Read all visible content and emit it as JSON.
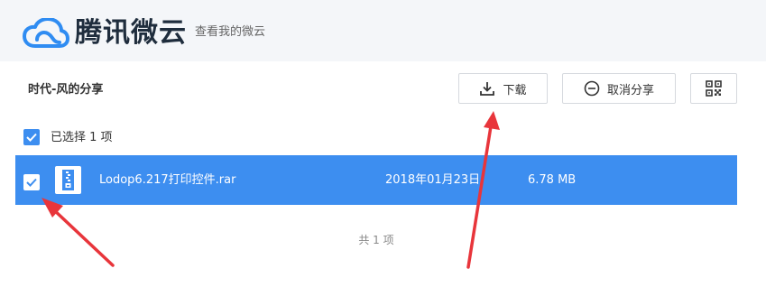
{
  "header": {
    "brand": "腾讯微云",
    "link": "查看我的微云"
  },
  "share": {
    "title": "时代-风的分享"
  },
  "toolbar": {
    "download_label": "下载",
    "cancel_share_label": "取消分享",
    "qr_icon": "qr-code-icon"
  },
  "selection": {
    "label": "已选择 1 项",
    "checked": true
  },
  "files": [
    {
      "name": "Lodop6.217打印控件.rar",
      "date": "2018年01月23日",
      "size": "6.78 MB",
      "checked": true,
      "icon": "archive-file-icon"
    }
  ],
  "footer": {
    "total": "共 1 项"
  },
  "colors": {
    "accent": "#3d8ef0",
    "header_bg": "#f4f6f9",
    "annotation_arrow": "#e8353b"
  }
}
